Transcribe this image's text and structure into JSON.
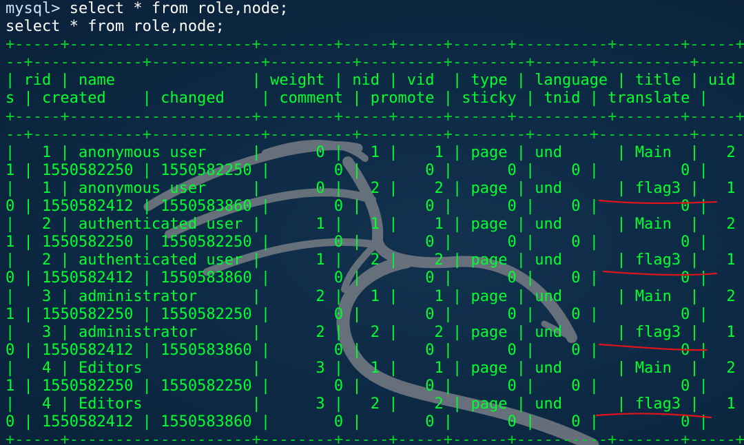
{
  "terminal": {
    "colors": {
      "background": "#0c2742",
      "text": "#00ff2e",
      "prompt": "#cfe3f5",
      "annotation": "#e0141a",
      "watermark": "#7a7f86"
    },
    "watermark_icon": "kali-dragon-icon",
    "prompt_line": {
      "prompt": "mysql> ",
      "command": "select * from role,node;"
    },
    "echo_line": "select * from role,node;",
    "lines": [
      "+-----+--------------------+--------+-----+-----+------+----------+-------+-----+----",
      "--+------------+------------+---------+---------+--------+------+----------+-----------+",
      "| rid | name               | weight | nid | vid  | type | language | title | uid | st",
      "s | created    | changed    | comment | promote | sticky | tnid | translate |",
      "+-----+--------------------+--------+-----+-----+------+----------+-------+-----+----",
      "--+------------+------------+---------+---------+--------+------+----------+-----------+",
      "|   1 | anonymous user     |      0 |   1 |    1 | page | und      | Main  |   2 |",
      "1 | 1550582250 | 1550582250 |       0 |       0 |      0 |    0 |         0 |",
      "|   1 | anonymous user     |      0 |   2 |    2 | page | und      | flag3 |   1 |",
      "0 | 1550582412 | 1550583860 |       0 |       0 |      0 |    0 |         0 |",
      "|   2 | authenticated user |      1 |   1 |    1 | page | und      | Main  |   2 |",
      "1 | 1550582250 | 1550582250 |       0 |       0 |      0 |    0 |         0 |",
      "|   2 | authenticated user |      1 |   2 |    2 | page | und      | flag3 |   1 |",
      "0 | 1550582412 | 1550583860 |       0 |       0 |      0 |    0 |         0 |",
      "|   3 | administrator      |      2 |   1 |    1 | page | und      | Main  |   2 |",
      "1 | 1550582250 | 1550582250 |       0 |       0 |      0 |    0 |         0 |",
      "|   3 | administrator      |      2 |   2 |    2 | page | und      | flag3 |   1 |",
      "0 | 1550582412 | 1550583860 |       0 |       0 |      0 |    0 |         0 |",
      "|   4 | Editors            |      3 |   1 |    1 | page | und      | Main  |   2 |",
      "1 | 1550582250 | 1550582250 |       0 |       0 |      0 |    0 |         0 |",
      "|   4 | Editors            |      3 |   2 |    2 | page | und      | flag3 |   1 |",
      "0 | 1550582412 | 1550583860 |       0 |       0 |      0 |    0 |         0 |",
      "+-----+--------------------+--------+-----+-----+------+----------+-------+-----+----"
    ]
  }
}
